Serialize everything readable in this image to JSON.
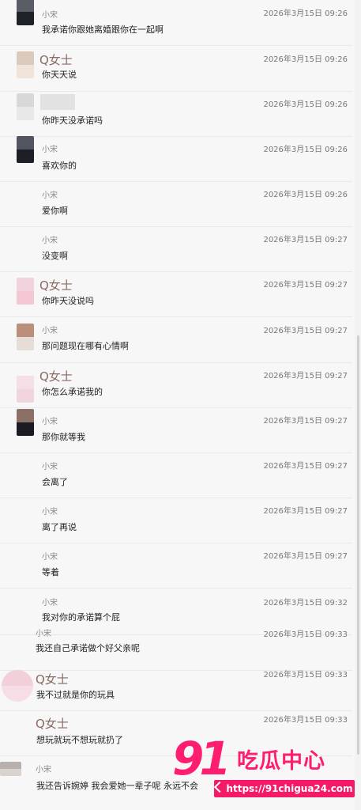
{
  "messages": [
    {
      "sender": "小宋",
      "time": "2026年3月15日 09:26",
      "text": "我承诺你跟她离婚跟你在一起啊",
      "avatar": {
        "top": "#5b5d66",
        "bottom": "#1f2229"
      }
    },
    {
      "sender": "Q女士",
      "time": "2026年3月15日 09:26",
      "text": "你天天说",
      "avatar": {
        "top": "#dbc9bb",
        "bottom": "#efe3da"
      }
    },
    {
      "sender": "",
      "time": "2026年3月15日 09:26",
      "text": "你昨天没承诺吗",
      "avatar": {
        "top": "#d8d8d8",
        "bottom": "#e8e8e8"
      }
    },
    {
      "sender": "小宋",
      "time": "2026年3月15日 09:26",
      "text": "喜欢你的",
      "avatar": {
        "top": "#525560",
        "bottom": "#1c1f27"
      }
    },
    {
      "sender": "小宋",
      "time": "2026年3月15日 09:26",
      "text": "爱你啊",
      "avatar": null
    },
    {
      "sender": "小宋",
      "time": "2026年3月15日 09:27",
      "text": "没变啊",
      "avatar": null
    },
    {
      "sender": "Q女士",
      "time": "2026年3月15日 09:27",
      "text": "你昨天没说吗",
      "avatar": {
        "top": "#f2d2dc",
        "bottom": "#f5c6d3"
      }
    },
    {
      "sender": "小宋",
      "time": "2026年3月15日 09:27",
      "text": "那问题现在哪有心情啊",
      "avatar": {
        "top": "#ba8f7b",
        "bottom": "#e8ddd6"
      }
    },
    {
      "sender": "Q女士",
      "time": "2026年3月15日 09:27",
      "text": "你怎么承诺我的",
      "avatar": {
        "top": "#f4dfe6",
        "bottom": "#f0d4de"
      }
    },
    {
      "sender": "小宋",
      "time": "2026年3月15日 09:27",
      "text": "那你就等我",
      "avatar": {
        "top": "#8a7066",
        "bottom": "#1a1c22"
      }
    },
    {
      "sender": "小宋",
      "time": "2026年3月15日 09:27",
      "text": "会离了",
      "avatar": null
    },
    {
      "sender": "小宋",
      "time": "2026年3月15日 09:27",
      "text": "离了再说",
      "avatar": null
    },
    {
      "sender": "小宋",
      "time": "2026年3月15日 09:27",
      "text": "等着",
      "avatar": null
    },
    {
      "sender": "小宋",
      "time": "2026年3月15日 09:32",
      "text": "我对你的承诺算个屁",
      "avatar": null
    },
    {
      "sender": "小宋",
      "time": "2026年3月15日 09:33",
      "text": "我还自己承诺做个好父亲呢",
      "avatar": null
    },
    {
      "sender": "Q女士",
      "time": "2026年3月15日 09:33",
      "text": "我不过就是你的玩具",
      "avatar": {
        "top": "#f2cfd9",
        "bottom": "#f7dde5"
      }
    },
    {
      "sender": "Q女士",
      "time": "2026年3月15日 09:33",
      "text": "想玩就玩不想玩就扔了",
      "avatar": null
    },
    {
      "sender": "小宋",
      "time": "",
      "text": "我还告诉婉婷 我会爱她一辈子呢 永远不会",
      "avatar": {
        "top": "#b8b0ad",
        "bottom": "#d9d3d0"
      }
    }
  ],
  "watermark": {
    "number": "91",
    "chinese": "吃瓜中心",
    "url": "https://91chigua24.com"
  }
}
